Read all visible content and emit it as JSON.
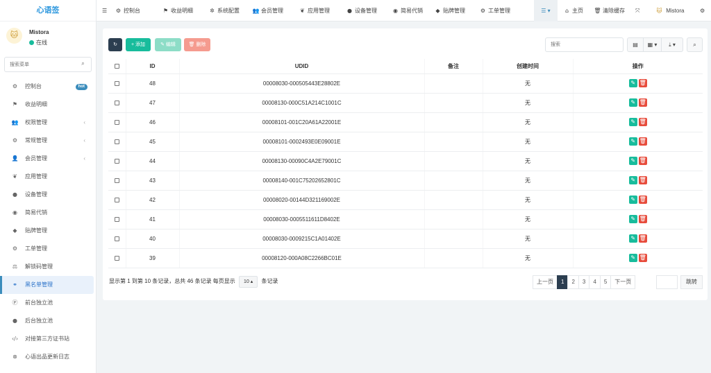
{
  "sidebar": {
    "logo": "心语签",
    "user": {
      "name": "Mistora",
      "status": "在线",
      "avatar": "🐱"
    },
    "search_placeholder": "搜索菜单",
    "menu": [
      {
        "icon": "⚙",
        "label": "控制台",
        "badge": "hot"
      },
      {
        "icon": "⚑",
        "label": "收益明细"
      },
      {
        "icon": "👥",
        "label": "权限管理",
        "arrow": "‹"
      },
      {
        "icon": "⚙",
        "label": "常规管理",
        "arrow": "‹"
      },
      {
        "icon": "👤",
        "label": "会员管理",
        "arrow": "‹"
      },
      {
        "icon": "❦",
        "label": "应用管理"
      },
      {
        "icon": "●",
        "label": "设备管理"
      },
      {
        "icon": "◉",
        "label": "简易代销"
      },
      {
        "icon": "◆",
        "label": "贴牌管理"
      },
      {
        "icon": "⚙",
        "label": "工单管理"
      },
      {
        "icon": "⚖",
        "label": "解锁码管理"
      },
      {
        "icon": "⚭",
        "label": "黑名单管理",
        "active": true
      },
      {
        "icon": "Ⓟ",
        "label": "前台独立池"
      },
      {
        "icon": "●",
        "label": "后台独立池"
      },
      {
        "icon": "‹/›",
        "label": "对接第三方证书站"
      },
      {
        "icon": "⊗",
        "label": "心语出品更新日志"
      }
    ]
  },
  "topnav": {
    "items": [
      {
        "icon": "⚙",
        "label": "控制台"
      },
      {
        "icon": "⚑",
        "label": "收益明细"
      },
      {
        "icon": "✲",
        "label": "系统配置"
      },
      {
        "icon": "👥",
        "label": "会员管理"
      },
      {
        "icon": "❦",
        "label": "应用管理"
      },
      {
        "icon": "●",
        "label": "设备管理"
      },
      {
        "icon": "◉",
        "label": "简易代销"
      },
      {
        "icon": "◆",
        "label": "贴牌管理"
      },
      {
        "icon": "⚙",
        "label": "工单管理"
      }
    ],
    "right": {
      "home": "主页",
      "clear_cache": "清除缓存",
      "fullscreen_icon": "⤧",
      "user": "Mistora",
      "settings_icon": "⚙"
    }
  },
  "toolbar": {
    "refresh_icon": "↻",
    "add": "+ 添加",
    "edit": "✎ 编辑",
    "delete": "🗑 删除",
    "search_placeholder": "搜索"
  },
  "table": {
    "headers": [
      "ID",
      "UDID",
      "备注",
      "创建时间",
      "操作"
    ],
    "rows": [
      {
        "id": "48",
        "udid": "00008030-000505443E28802E",
        "remark": "",
        "created": "无"
      },
      {
        "id": "47",
        "udid": "00008130-000C51A214C1001C",
        "remark": "",
        "created": "无"
      },
      {
        "id": "46",
        "udid": "00008101-001C20A61A22001E",
        "remark": "",
        "created": "无"
      },
      {
        "id": "45",
        "udid": "00008101-0002493E0E09001E",
        "remark": "",
        "created": "无"
      },
      {
        "id": "44",
        "udid": "00008130-00090C4A2E79001C",
        "remark": "",
        "created": "无"
      },
      {
        "id": "43",
        "udid": "00008140-001C75202652801C",
        "remark": "",
        "created": "无"
      },
      {
        "id": "42",
        "udid": "00008020-00144D321169002E",
        "remark": "",
        "created": "无"
      },
      {
        "id": "41",
        "udid": "00008030-0005511611D8402E",
        "remark": "",
        "created": "无"
      },
      {
        "id": "40",
        "udid": "00008030-0009215C1A01402E",
        "remark": "",
        "created": "无"
      },
      {
        "id": "39",
        "udid": "00008120-000A08C2266BC01E",
        "remark": "",
        "created": "无"
      }
    ]
  },
  "footer": {
    "info_prefix": "显示第 1 到第 10 条记录，总共 46 条记录 每页显示",
    "page_size": "10 ▴",
    "info_suffix": "条记录",
    "prev": "上一页",
    "pages": [
      "1",
      "2",
      "3",
      "4",
      "5"
    ],
    "current_page": "1",
    "next": "下一页",
    "jump": "跳转"
  },
  "colors": {
    "accent": "#3c8dbc",
    "success": "#18bc9c",
    "danger": "#e74c3c",
    "dark": "#2c3e50"
  }
}
